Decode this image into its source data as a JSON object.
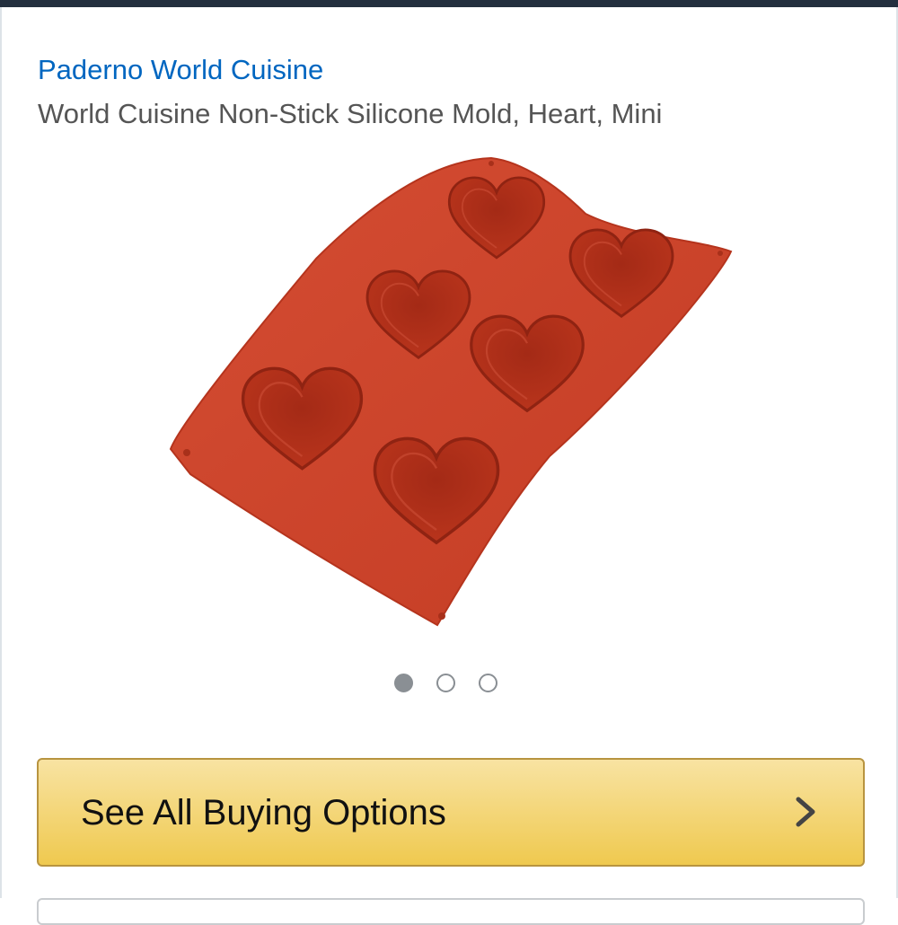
{
  "product": {
    "brand": "Paderno World Cuisine",
    "title": "World Cuisine Non-Stick Silicone Mold, Heart, Mini"
  },
  "carousel": {
    "total_images": 3,
    "active_index": 0
  },
  "actions": {
    "buy_options_label": "See All Buying Options",
    "buy_options_icon": "chevron-right-icon"
  },
  "colors": {
    "brand_link": "#0066c0",
    "button_gradient_top": "#f8e3a2",
    "button_gradient_bottom": "#efc94f",
    "mold": "#c9422a"
  }
}
